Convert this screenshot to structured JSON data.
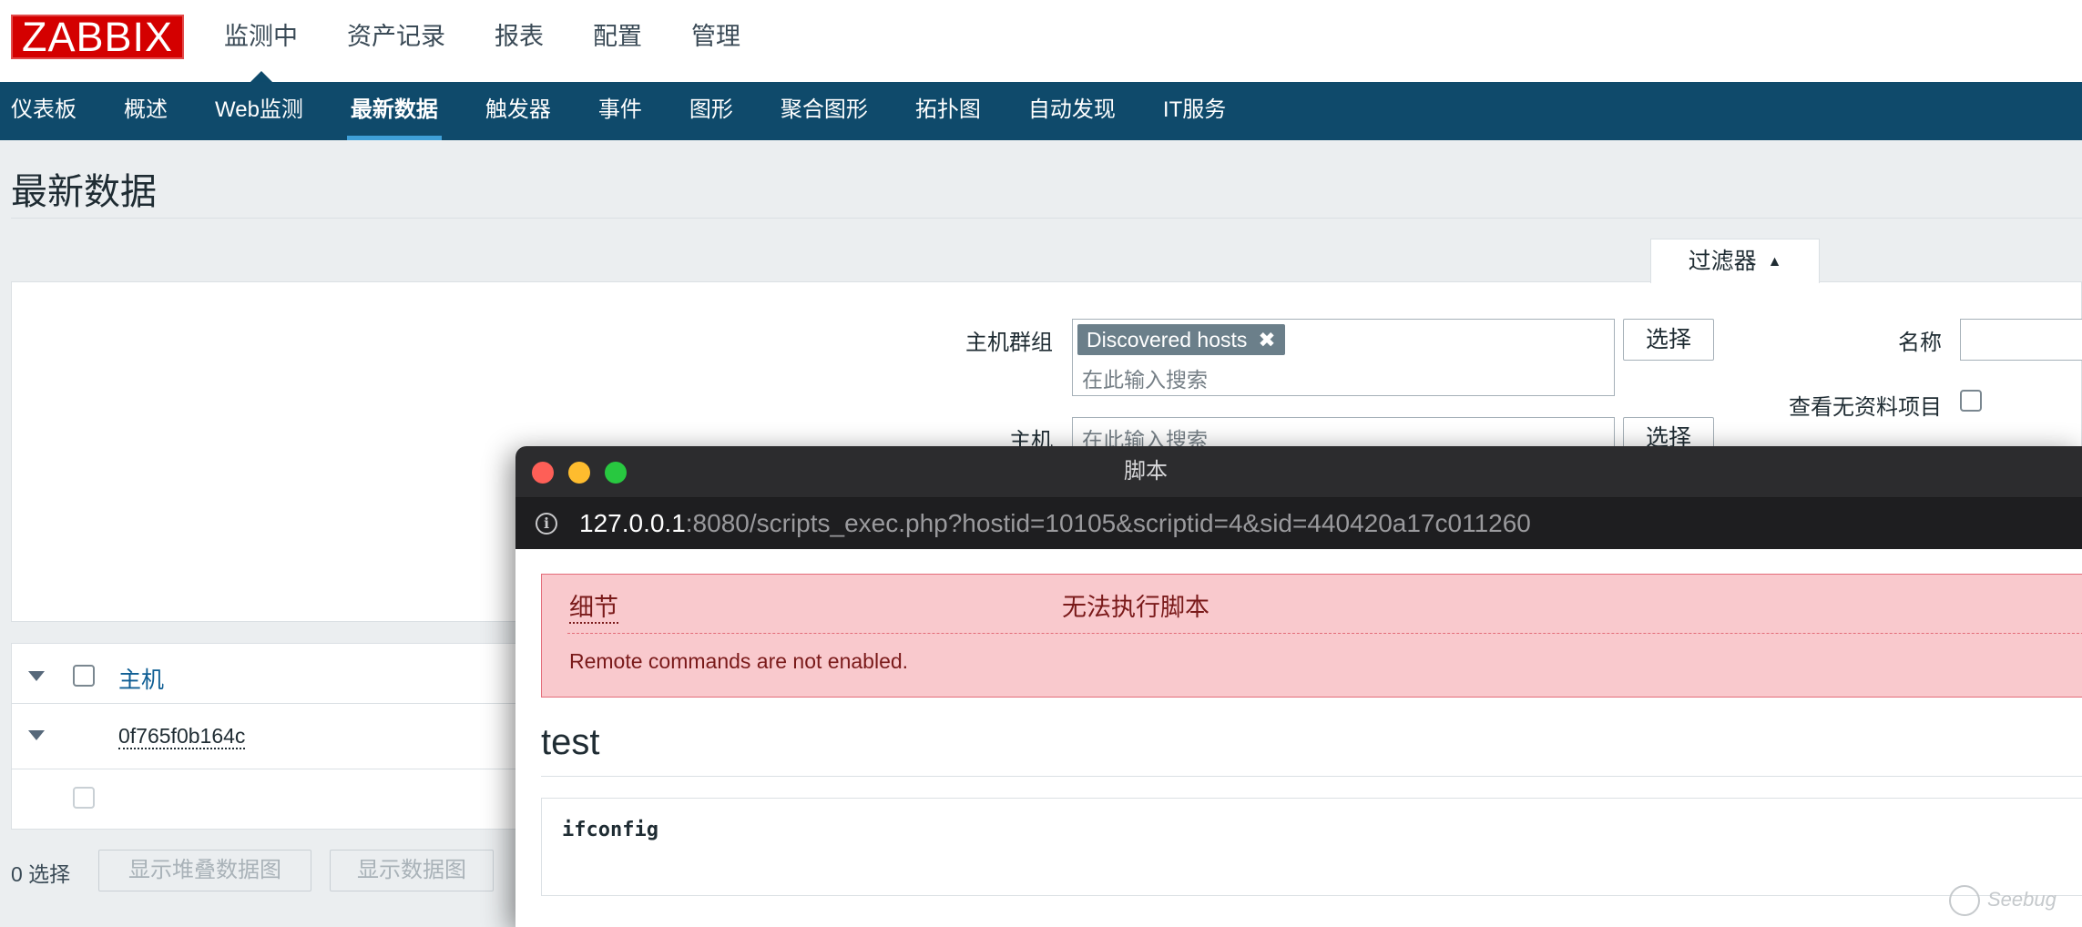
{
  "logo": "ZABBIX",
  "main_menu": [
    "监测中",
    "资产记录",
    "报表",
    "配置",
    "管理"
  ],
  "sub_menu": [
    "仪表板",
    "概述",
    "Web监测",
    "最新数据",
    "触发器",
    "事件",
    "图形",
    "聚合图形",
    "拓扑图",
    "自动发现",
    "IT服务"
  ],
  "page_title": "最新数据",
  "filter": {
    "tab_label": "过滤器",
    "host_group_label": "主机群组",
    "host_group_tag": "Discovered hosts",
    "search_placeholder": "在此输入搜索",
    "host_label": "主机",
    "select_button": "选择",
    "name_label": "名称",
    "show_no_data_label": "查看无资料项目"
  },
  "table": {
    "host_header": "主机",
    "host_row": "0f765f0b164c"
  },
  "footer": {
    "selected": "0 选择",
    "btn_stacked": "显示堆叠数据图",
    "btn_graph": "显示数据图"
  },
  "popup": {
    "title": "脚本",
    "url_host": "127.0.0.1",
    "url_rest": ":8080/scripts_exec.php?hostid=10105&scriptid=4&sid=440420a17c011260",
    "error_details": "细节",
    "error_title": "无法执行脚本",
    "error_message": "Remote commands are not enabled.",
    "script_name": "test",
    "script_output": "ifconfig",
    "traffic_lights": {
      "close": "#fe5f57",
      "minimize": "#febc2e",
      "zoom": "#28c840"
    }
  },
  "colors": {
    "brand": "#d40000",
    "nav": "#0f4a6b",
    "accent": "#3fa0d8",
    "error_bg": "#f9c9cd"
  },
  "watermark": "Seebug"
}
